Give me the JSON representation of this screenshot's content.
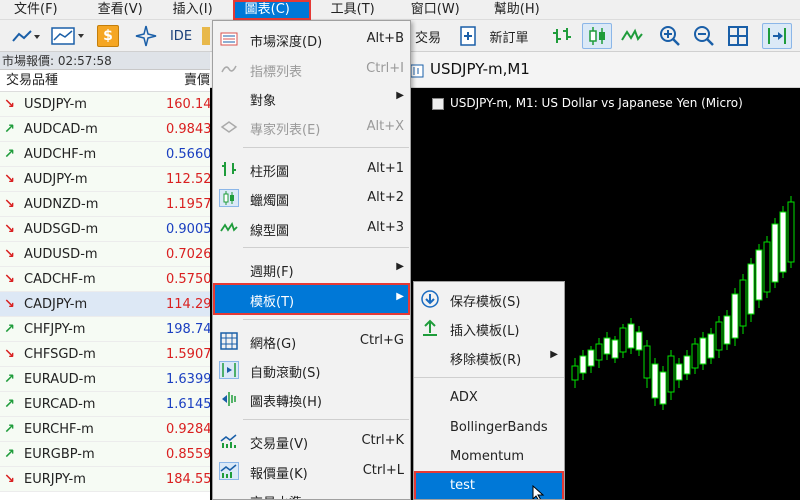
{
  "menubar": {
    "items": [
      {
        "label": "文件(F)"
      },
      {
        "label": "查看(V)"
      },
      {
        "label": "插入(I)"
      },
      {
        "label": "圖表(C)"
      },
      {
        "label": "工具(T)"
      },
      {
        "label": "窗口(W)"
      },
      {
        "label": "幫助(H)"
      }
    ]
  },
  "toolbar": {
    "ide_label": "IDE",
    "trade_label": "交易",
    "new_order_label": "新訂單",
    "dollar_icon": "$"
  },
  "market_watch": {
    "header": "市場報價: 02:57:58",
    "col_symbol": "交易品種",
    "col_bid": "賣價",
    "rows": [
      {
        "symbol": "USDJPY-m",
        "bid": "160.143",
        "dir": "down",
        "color": "red"
      },
      {
        "symbol": "AUDCAD-m",
        "bid": "0.98436",
        "dir": "up",
        "color": "red"
      },
      {
        "symbol": "AUDCHF-m",
        "bid": "0.56605",
        "dir": "up",
        "color": "blue"
      },
      {
        "symbol": "AUDJPY-m",
        "bid": "112.520",
        "dir": "down",
        "color": "red"
      },
      {
        "symbol": "AUDNZD-m",
        "bid": "1.19570",
        "dir": "down",
        "color": "red"
      },
      {
        "symbol": "AUDSGD-m",
        "bid": "0.90050",
        "dir": "down",
        "color": "blue"
      },
      {
        "symbol": "AUDUSD-m",
        "bid": "0.70263",
        "dir": "down",
        "color": "red"
      },
      {
        "symbol": "CADCHF-m",
        "bid": "0.57503",
        "dir": "down",
        "color": "red"
      },
      {
        "symbol": "CADJPY-m",
        "bid": "114.298",
        "dir": "down",
        "color": "red"
      },
      {
        "symbol": "CHFJPY-m",
        "bid": "198.745",
        "dir": "up",
        "color": "blue"
      },
      {
        "symbol": "CHFSGD-m",
        "bid": "1.59070",
        "dir": "down",
        "color": "red"
      },
      {
        "symbol": "EURAUD-m",
        "bid": "1.63995",
        "dir": "up",
        "color": "blue"
      },
      {
        "symbol": "EURCAD-m",
        "bid": "1.61453",
        "dir": "up",
        "color": "blue"
      },
      {
        "symbol": "EURCHF-m",
        "bid": "0.92847",
        "dir": "up",
        "color": "red"
      },
      {
        "symbol": "EURGBP-m",
        "bid": "0.85597",
        "dir": "up",
        "color": "red"
      },
      {
        "symbol": "EURJPY-m",
        "bid": "184.552",
        "dir": "down",
        "color": "red"
      }
    ]
  },
  "chart": {
    "tab_label": "USDJPY-m,M1",
    "info_text": "USDJPY-m, M1:  US Dollar vs Japanese Yen (Micro)"
  },
  "chart_menu": {
    "items": [
      {
        "label": "市場深度(D)",
        "shortcut": "Alt+B",
        "icon": "depth-icon"
      },
      {
        "label": "指標列表",
        "shortcut": "Ctrl+I",
        "icon": "indicator-list-icon",
        "disabled": true
      },
      {
        "label": "對象",
        "shortcut": "",
        "icon": "",
        "submenu": true
      },
      {
        "label": "專家列表(E)",
        "shortcut": "Alt+X",
        "icon": "expert-icon",
        "disabled": true
      },
      {
        "label": "柱形圖",
        "shortcut": "Alt+1",
        "icon": "bar-chart-icon"
      },
      {
        "label": "蠟燭圖",
        "shortcut": "Alt+2",
        "icon": "candlestick-icon"
      },
      {
        "label": "線型圖",
        "shortcut": "Alt+3",
        "icon": "line-chart-icon"
      },
      {
        "label": "週期(F)",
        "shortcut": "",
        "icon": "",
        "submenu": true
      },
      {
        "label": "模板(T)",
        "shortcut": "",
        "icon": "",
        "submenu": true,
        "highlighted": true
      },
      {
        "label": "網格(G)",
        "shortcut": "Ctrl+G",
        "icon": "grid-icon"
      },
      {
        "label": "自動滾動(S)",
        "shortcut": "",
        "icon": "auto-scroll-icon"
      },
      {
        "label": "圖表轉換(H)",
        "shortcut": "",
        "icon": "chart-shift-icon"
      },
      {
        "label": "交易量(V)",
        "shortcut": "Ctrl+K",
        "icon": "volume-icon"
      },
      {
        "label": "報價量(K)",
        "shortcut": "Ctrl+L",
        "icon": "tick-volume-icon"
      },
      {
        "label": "交易水準",
        "shortcut": "",
        "icon": "trade-levels-icon"
      }
    ]
  },
  "template_submenu": {
    "items": [
      {
        "label": "保存模板(S)",
        "icon": "save-template-icon"
      },
      {
        "label": "插入模板(L)",
        "icon": "load-template-icon"
      },
      {
        "label": "移除模板(R)",
        "icon": "",
        "submenu": true
      },
      {
        "label": "ADX",
        "icon": ""
      },
      {
        "label": "BollingerBands",
        "icon": ""
      },
      {
        "label": "Momentum",
        "icon": ""
      },
      {
        "label": "test",
        "icon": "",
        "highlighted": true
      }
    ]
  },
  "colors": {
    "accent": "#0078d7",
    "highlight_border": "#e53935",
    "up": "#1f9c3b",
    "down": "#d92020",
    "bid_red": "#d92020",
    "bid_blue": "#1a3fc0",
    "chart_bg": "#000000"
  }
}
